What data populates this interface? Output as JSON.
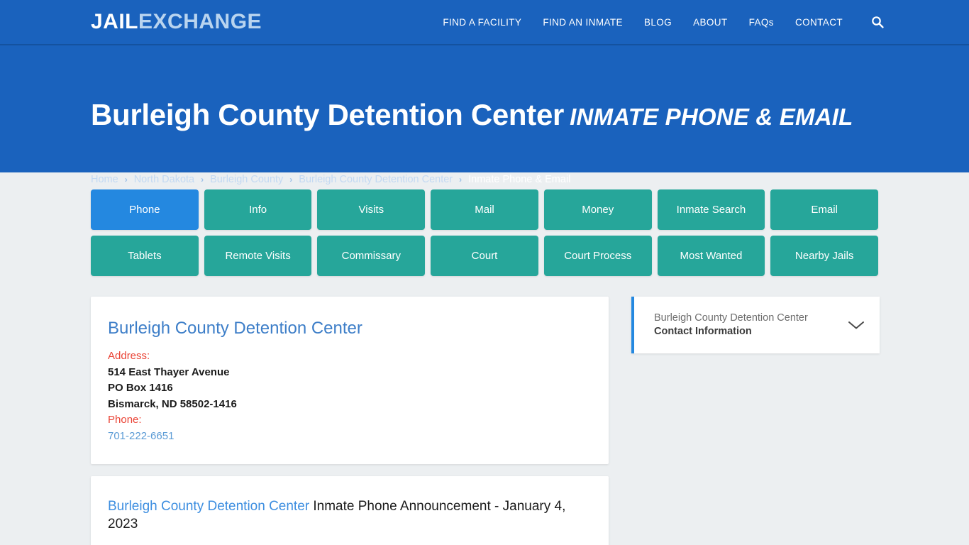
{
  "header": {
    "logo_primary": "JAIL",
    "logo_secondary": "EXCHANGE",
    "nav": [
      {
        "label": "FIND A FACILITY"
      },
      {
        "label": "FIND AN INMATE"
      },
      {
        "label": "BLOG"
      },
      {
        "label": "ABOUT"
      },
      {
        "label": "FAQs"
      },
      {
        "label": "CONTACT"
      }
    ],
    "search_icon": "search-icon",
    "background_color": "#1a62bd"
  },
  "hero": {
    "title_main": "Burleigh County Detention Center",
    "title_sub": "INMATE PHONE & EMAIL",
    "breadcrumb": [
      {
        "label": "Home",
        "active": false
      },
      {
        "label": "North Dakota",
        "active": false
      },
      {
        "label": "Burleigh County",
        "active": false
      },
      {
        "label": "Burleigh County Detention Center",
        "active": false
      },
      {
        "label": "Inmate Phone & Email",
        "active": true
      }
    ],
    "separator": "›"
  },
  "tabs": {
    "active_color": "#2488e0",
    "default_color": "#26a69a",
    "row1": [
      {
        "label": "Phone",
        "active": true
      },
      {
        "label": "Info",
        "active": false
      },
      {
        "label": "Visits",
        "active": false
      },
      {
        "label": "Mail",
        "active": false
      },
      {
        "label": "Money",
        "active": false
      },
      {
        "label": "Inmate Search",
        "active": false
      },
      {
        "label": "Email",
        "active": false
      }
    ],
    "row2": [
      {
        "label": "Tablets",
        "active": false
      },
      {
        "label": "Remote Visits",
        "active": false
      },
      {
        "label": "Commissary",
        "active": false
      },
      {
        "label": "Court",
        "active": false
      },
      {
        "label": "Court Process",
        "active": false
      },
      {
        "label": "Most Wanted",
        "active": false
      },
      {
        "label": "Nearby Jails",
        "active": false
      }
    ]
  },
  "facility_card": {
    "name": "Burleigh County Detention Center",
    "address_label": "Address:",
    "address_line1": "514 East Thayer Avenue",
    "address_line2": "PO Box 1416",
    "address_line3": "Bismarck, ND 58502-1416",
    "phone_label": "Phone:",
    "phone": "701-222-6651"
  },
  "announcement_card": {
    "link_text": "Burleigh County Detention Center",
    "rest_text": " Inmate Phone Announcement - January 4, 2023"
  },
  "sidebar": {
    "accordion": {
      "subtitle": "Burleigh County Detention Center",
      "title": "Contact Information",
      "chevron_icon": "chevron-down-icon",
      "accent_color": "#2488e0"
    }
  }
}
